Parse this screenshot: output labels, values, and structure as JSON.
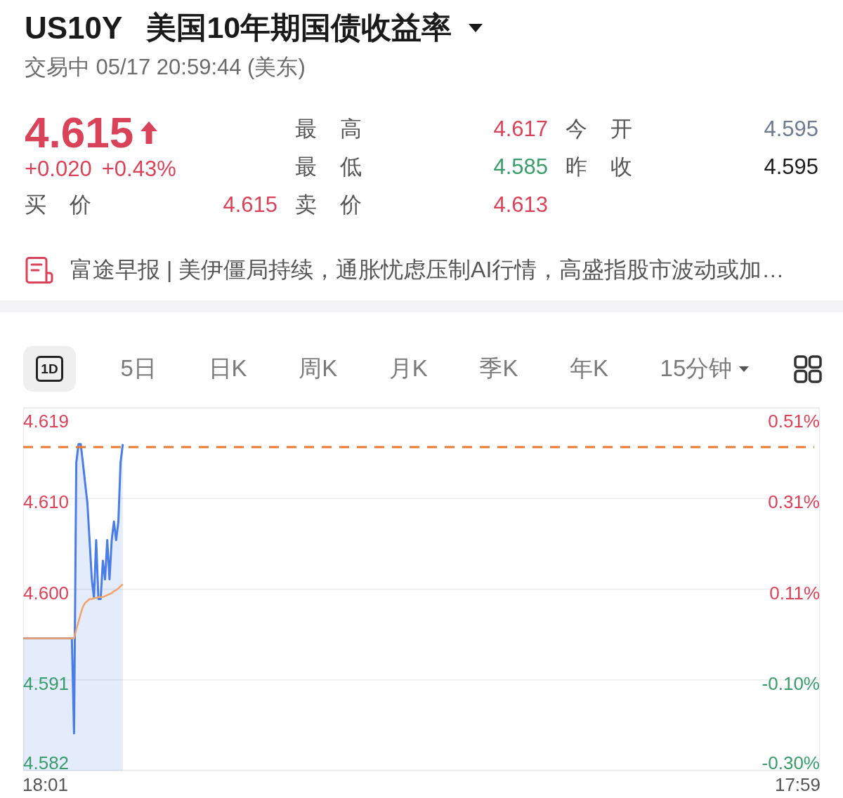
{
  "header": {
    "symbol": "US10Y",
    "name": "美国10年期国债收益率",
    "status": "交易中 05/17 20:59:44 (美东)"
  },
  "quote": {
    "price": "4.615",
    "rising": true,
    "change": "+0.020",
    "change_percent": "+0.43%"
  },
  "stats": [
    {
      "label": "最 高",
      "value": "4.617",
      "color": "#d9435a"
    },
    {
      "label": "今 开",
      "value": "4.595",
      "color": "#6f7a8f"
    },
    {
      "label": "最 低",
      "value": "4.585",
      "color": "#3a9b6b"
    },
    {
      "label": "昨 收",
      "value": "4.595",
      "color": "#1a1a1a"
    },
    {
      "label": "买 价",
      "value": "4.615",
      "color": "#d9435a"
    },
    {
      "label": "卖 价",
      "value": "4.613",
      "color": "#d9435a"
    }
  ],
  "news": {
    "headline": "富途早报 | 美伊僵局持续，通胀忧虑压制AI行情，高盛指股市波动或加…"
  },
  "tabs": [
    {
      "label": "1D",
      "kind": "boxed",
      "selected": true
    },
    {
      "label": "5日",
      "kind": "text",
      "selected": false
    },
    {
      "label": "日K",
      "kind": "text",
      "selected": false
    },
    {
      "label": "周K",
      "kind": "text",
      "selected": false
    },
    {
      "label": "月K",
      "kind": "text",
      "selected": false
    },
    {
      "label": "季K",
      "kind": "text",
      "selected": false
    },
    {
      "label": "年K",
      "kind": "text",
      "selected": false
    },
    {
      "label": "15分钟",
      "kind": "dropdown",
      "selected": false
    }
  ],
  "chart": {
    "chart_data": {
      "type": "line",
      "grid": true,
      "categories": [
        null,
        null,
        null,
        null,
        null,
        null,
        null,
        null,
        null,
        null,
        "18:01",
        null,
        null,
        null,
        null,
        null,
        null,
        null,
        null,
        null,
        null,
        null,
        null,
        null,
        null,
        null,
        null,
        null,
        null,
        null,
        null,
        null,
        null,
        null,
        null,
        null,
        null,
        null,
        null,
        null,
        null,
        null,
        null,
        null,
        null,
        null,
        null,
        null,
        null,
        null,
        null,
        null,
        null,
        null,
        null,
        null,
        null,
        null,
        null,
        null,
        null,
        null,
        null,
        null,
        null,
        null,
        null,
        null,
        null,
        null,
        null,
        null,
        null,
        null,
        null,
        null,
        null,
        null,
        null,
        null,
        null,
        null,
        null,
        null,
        null,
        null,
        null,
        null,
        null,
        null,
        null,
        null,
        null,
        null,
        null,
        null,
        null,
        null,
        null,
        null,
        null,
        null,
        null,
        null,
        null,
        null,
        null,
        null,
        null,
        null,
        null,
        null,
        null,
        null,
        null,
        null,
        null,
        null,
        null,
        null,
        null,
        null,
        null,
        null,
        null,
        null,
        null,
        null,
        null,
        null,
        null,
        null,
        null,
        null,
        null,
        null,
        null,
        null,
        null,
        null,
        null,
        null,
        null,
        null,
        null,
        null,
        null,
        null,
        null,
        null,
        null,
        null,
        null,
        null,
        null,
        null,
        null,
        null,
        null,
        null,
        null,
        null,
        null,
        null,
        null,
        null,
        null,
        null,
        null,
        null,
        null,
        null,
        null,
        null,
        null,
        null,
        null,
        null,
        null,
        null,
        null,
        null,
        null,
        null,
        null,
        null,
        null,
        null,
        null,
        null,
        null,
        null,
        null,
        null,
        null,
        null,
        null,
        null,
        null,
        null,
        null,
        null,
        null,
        null,
        null,
        null,
        null,
        null,
        null,
        null,
        null,
        null,
        null,
        null,
        null,
        null,
        null,
        null,
        null,
        null,
        null,
        null,
        null,
        null,
        null,
        null,
        null,
        null,
        null,
        null,
        null,
        null,
        null,
        null,
        null,
        null,
        null,
        null,
        null,
        null,
        null,
        null,
        null,
        null,
        null,
        null,
        null,
        null,
        null,
        null,
        null,
        null,
        null,
        null,
        null,
        null,
        null,
        null,
        null,
        null,
        null,
        null,
        null,
        null,
        null,
        null,
        null,
        null,
        null,
        null,
        null,
        null,
        null,
        null,
        null,
        null,
        null,
        null,
        null,
        null,
        null,
        null,
        null,
        null,
        null,
        null,
        null,
        null,
        null,
        null,
        null,
        null,
        null,
        null,
        null,
        null,
        null,
        null,
        null,
        null,
        null,
        null,
        null,
        null,
        null,
        null,
        null,
        null,
        null,
        null,
        null,
        null,
        null,
        null,
        null,
        null,
        null,
        null,
        null,
        null,
        null,
        null,
        null,
        null,
        null,
        null,
        null,
        null,
        null,
        null,
        null,
        null,
        null,
        null,
        null,
        null,
        null,
        null,
        null,
        null,
        null,
        null,
        null,
        null,
        null,
        null,
        null,
        null,
        null,
        null,
        "17:59",
        null,
        null,
        null,
        null,
        null,
        null,
        null,
        null,
        null,
        null
      ],
      "series": [
        {
          "type": "area",
          "color": "#4a7ee6",
          "values": [
            4.5955,
            4.5955,
            4.5955,
            4.5955,
            4.5955,
            4.5955,
            4.5955,
            4.5955,
            4.5955,
            4.5955,
            4.5955,
            4.5955,
            4.5955,
            4.5955,
            4.5955,
            4.5955,
            4.5955,
            4.5955,
            4.5955,
            4.5955,
            4.5955,
            4.5955,
            4.5955,
            4.5858,
            4.6134,
            4.6153,
            4.6153,
            4.6134,
            4.6113,
            4.6093,
            4.6055,
            4.6015,
            4.5996,
            4.6055,
            4.5995,
            4.5995,
            4.6034,
            4.6015,
            4.6055,
            4.6015,
            4.6055,
            4.6074,
            4.6055,
            4.6074,
            4.6134,
            4.6153,
            null,
            null,
            null,
            null,
            null,
            null,
            null,
            null,
            null,
            null,
            null,
            null,
            null,
            null,
            null,
            null,
            null,
            null,
            null,
            null,
            null,
            null,
            null,
            null,
            null,
            null,
            null,
            null,
            null,
            null,
            null,
            null,
            null,
            null,
            null,
            null,
            null,
            null,
            null,
            null,
            null,
            null,
            null,
            null,
            null,
            null,
            null,
            null,
            null,
            null,
            null,
            null,
            null,
            null,
            null,
            null,
            null,
            null,
            null,
            null,
            null,
            null,
            null,
            null,
            null,
            null,
            null,
            null,
            null,
            null,
            null,
            null,
            null,
            null,
            null,
            null,
            null,
            null,
            null,
            null,
            null,
            null,
            null,
            null,
            null,
            null,
            null,
            null,
            null,
            null,
            null,
            null,
            null,
            null,
            null,
            null,
            null,
            null,
            null,
            null,
            null,
            null,
            null,
            null,
            null,
            null,
            null,
            null,
            null,
            null,
            null,
            null,
            null,
            null,
            null,
            null,
            null,
            null,
            null,
            null,
            null,
            null,
            null,
            null,
            null,
            null,
            null,
            null,
            null,
            null,
            null,
            null,
            null,
            null,
            null,
            null,
            null,
            null,
            null,
            null,
            null,
            null,
            null,
            null,
            null,
            null,
            null,
            null,
            null,
            null,
            null,
            null,
            null,
            null,
            null,
            null,
            null,
            null,
            null,
            null,
            null,
            null,
            null,
            null,
            null,
            null,
            null,
            null,
            null,
            null,
            null,
            null,
            null,
            null,
            null,
            null,
            null,
            null,
            null,
            null,
            null,
            null,
            null,
            null,
            null,
            null,
            null,
            null,
            null,
            null,
            null,
            null,
            null,
            null,
            null,
            null,
            null,
            null,
            null,
            null,
            null,
            null,
            null,
            null,
            null,
            null,
            null,
            null,
            null,
            null,
            null,
            null,
            null,
            null,
            null,
            null,
            null,
            null,
            null,
            null,
            null,
            null,
            null,
            null,
            null,
            null,
            null,
            null,
            null,
            null,
            null,
            null,
            null,
            null,
            null,
            null,
            null,
            null,
            null,
            null,
            null,
            null,
            null,
            null,
            null,
            null,
            null,
            null,
            null,
            null,
            null,
            null,
            null,
            null,
            null,
            null,
            null,
            null,
            null,
            null,
            null,
            null,
            null,
            null,
            null,
            null,
            null,
            null,
            null,
            null,
            null,
            null,
            null,
            null,
            null,
            null,
            null,
            null,
            null,
            null,
            null,
            null,
            null,
            null,
            null,
            null,
            null,
            null,
            null,
            null,
            null,
            null,
            null,
            null,
            null,
            null,
            null,
            null,
            null,
            null,
            null,
            null,
            null,
            null,
            null,
            null,
            null,
            null,
            null,
            null,
            null,
            null,
            null,
            null,
            null
          ]
        },
        {
          "type": "line",
          "color": "#f0a36e",
          "values": [
            4.5955,
            4.5955,
            4.5955,
            4.5955,
            4.5955,
            4.5955,
            4.5955,
            4.5955,
            4.5955,
            4.5955,
            4.5955,
            4.5955,
            4.5955,
            4.5955,
            4.5955,
            4.5955,
            4.5955,
            4.5955,
            4.5955,
            4.5955,
            4.5955,
            4.5955,
            4.5955,
            4.5955,
            4.5964,
            4.5972,
            4.598,
            4.5987,
            4.5991,
            4.5993,
            4.5995,
            4.5995,
            4.5996,
            4.5996,
            4.5997,
            4.5997,
            4.5997,
            4.5998,
            4.5999,
            4.6,
            4.6001,
            4.6003,
            4.6004,
            4.6006,
            4.6008,
            4.601,
            null,
            null,
            null,
            null,
            null,
            null,
            null,
            null,
            null,
            null,
            null,
            null,
            null,
            null,
            null,
            null,
            null,
            null,
            null,
            null,
            null,
            null,
            null,
            null,
            null,
            null,
            null,
            null,
            null,
            null,
            null,
            null,
            null,
            null,
            null,
            null,
            null,
            null,
            null,
            null,
            null,
            null,
            null,
            null,
            null,
            null,
            null,
            null,
            null,
            null,
            null,
            null,
            null,
            null,
            null,
            null,
            null,
            null,
            null,
            null,
            null,
            null,
            null,
            null,
            null,
            null,
            null,
            null,
            null,
            null,
            null,
            null,
            null,
            null,
            null,
            null,
            null,
            null,
            null,
            null,
            null,
            null,
            null,
            null,
            null,
            null,
            null,
            null,
            null,
            null,
            null,
            null,
            null,
            null,
            null,
            null,
            null,
            null,
            null,
            null,
            null,
            null,
            null,
            null,
            null,
            null,
            null,
            null,
            null,
            null,
            null,
            null,
            null,
            null,
            null,
            null,
            null,
            null,
            null,
            null,
            null,
            null,
            null,
            null,
            null,
            null,
            null,
            null,
            null,
            null,
            null,
            null,
            null,
            null,
            null,
            null,
            null,
            null,
            null,
            null,
            null,
            null,
            null,
            null,
            null,
            null,
            null,
            null,
            null,
            null,
            null,
            null,
            null,
            null,
            null,
            null,
            null,
            null,
            null,
            null,
            null,
            null,
            null,
            null,
            null,
            null,
            null,
            null,
            null,
            null,
            null,
            null,
            null,
            null,
            null,
            null,
            null,
            null,
            null,
            null,
            null,
            null,
            null,
            null,
            null,
            null,
            null,
            null,
            null,
            null,
            null,
            null,
            null,
            null,
            null,
            null,
            null,
            null,
            null,
            null,
            null,
            null,
            null,
            null,
            null,
            null,
            null,
            null,
            null,
            null,
            null,
            null,
            null,
            null,
            null,
            null,
            null,
            null,
            null,
            null,
            null,
            null,
            null,
            null,
            null,
            null,
            null,
            null,
            null,
            null,
            null,
            null,
            null,
            null,
            null,
            null,
            null,
            null,
            null,
            null,
            null,
            null,
            null,
            null,
            null,
            null,
            null,
            null,
            null,
            null,
            null,
            null,
            null,
            null,
            null,
            null,
            null,
            null,
            null,
            null,
            null,
            null,
            null,
            null,
            null,
            null,
            null,
            null,
            null,
            null,
            null,
            null,
            null,
            null,
            null,
            null,
            null,
            null,
            null,
            null,
            null,
            null,
            null,
            null,
            null,
            null,
            null,
            null,
            null,
            null,
            null,
            null,
            null,
            null,
            null,
            null,
            null,
            null,
            null,
            null,
            null,
            null,
            null,
            null,
            null,
            null,
            null,
            null,
            null,
            null,
            null,
            null,
            null,
            null,
            null
          ]
        }
      ],
      "ylim": [
        4.582,
        4.619
      ],
      "yticks": [
        {
          "value": 4.619,
          "label": "4.619"
        },
        {
          "value": 4.60975,
          "label": "4.610"
        },
        {
          "value": 4.6005,
          "label": "4.600"
        },
        {
          "value": 4.59125,
          "label": "4.591"
        },
        {
          "value": 4.582,
          "label": "4.582"
        }
      ],
      "ref_lines": [
        {
          "axis": "y",
          "value": 4.615
        }
      ]
    },
    "right_axis": [
      {
        "label": "0.51%",
        "color": "#d9435a"
      },
      {
        "label": "0.31%",
        "color": "#d9435a"
      },
      {
        "label": "0.11%",
        "color": "#d9435a"
      },
      {
        "label": "-0.10%",
        "color": "#3a9b6b"
      },
      {
        "label": "-0.30%",
        "color": "#3a9b6b"
      }
    ]
  }
}
